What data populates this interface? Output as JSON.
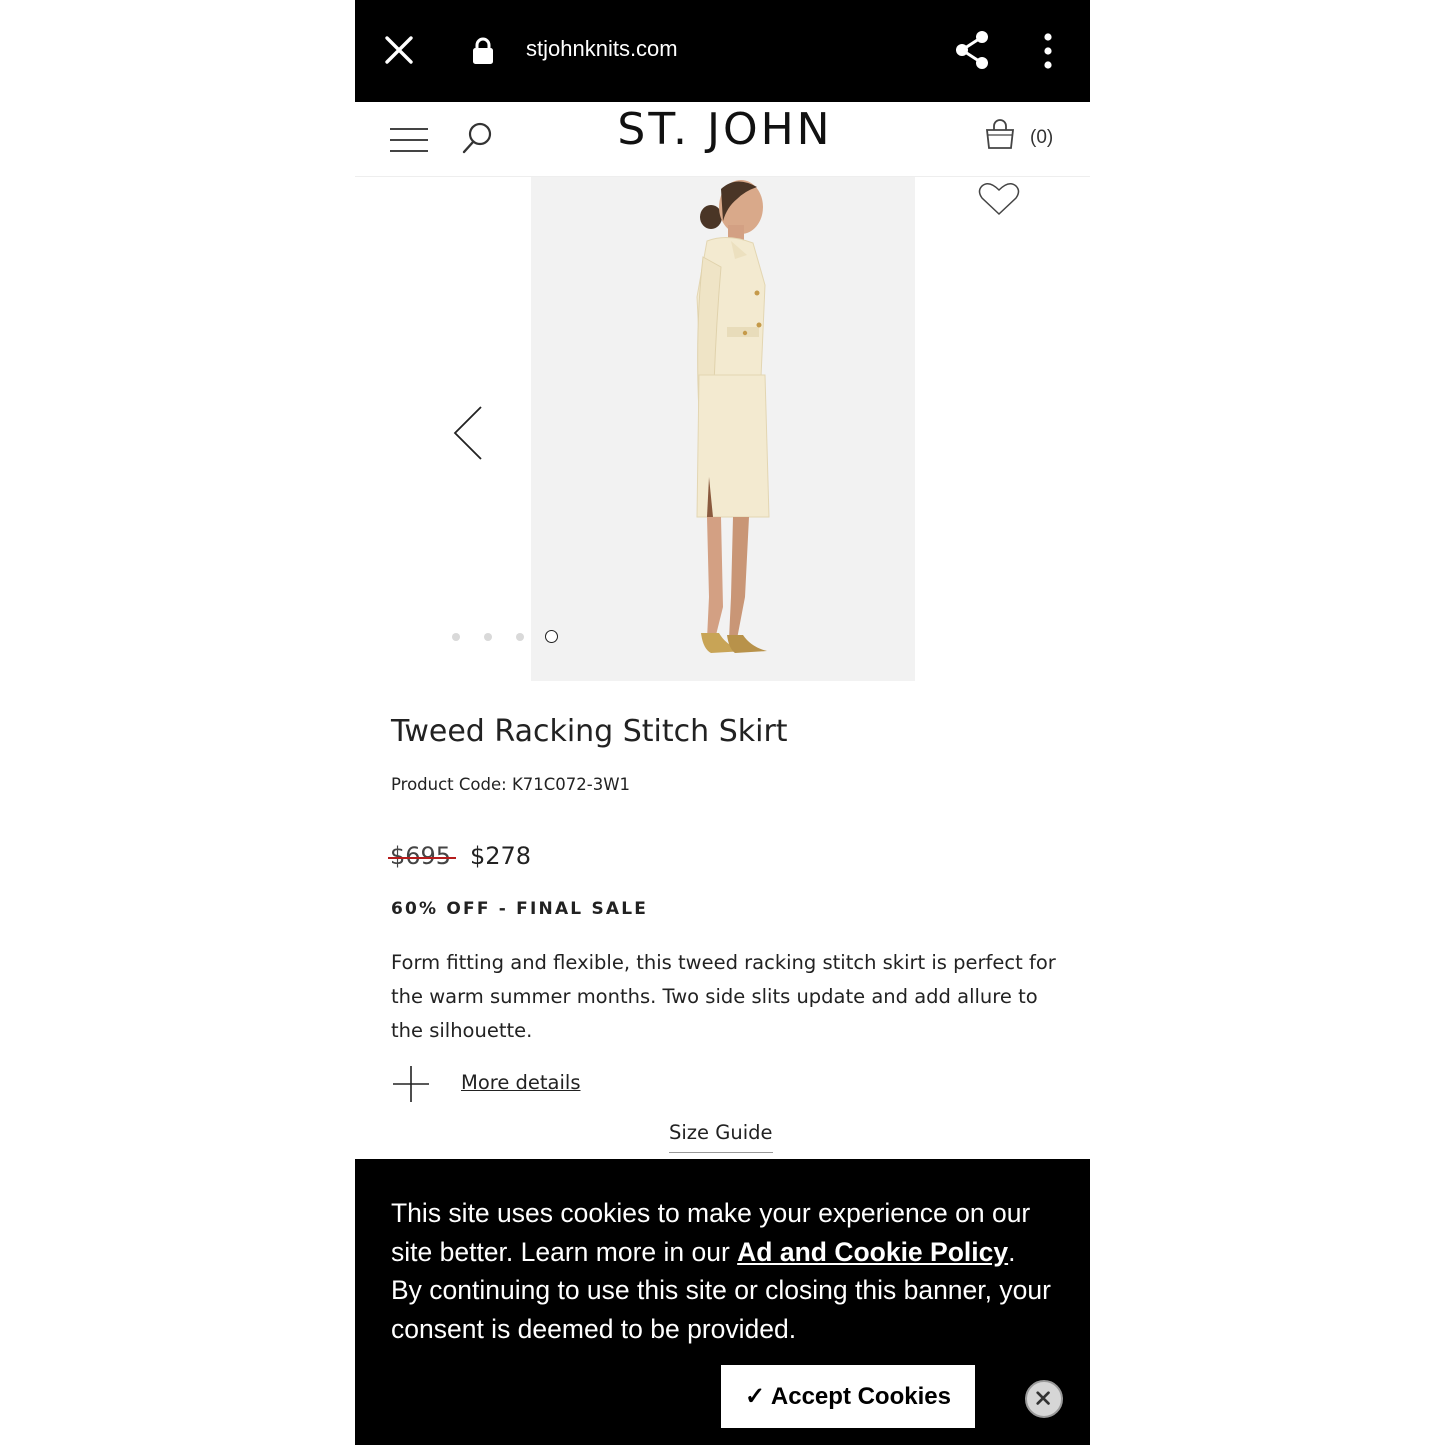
{
  "browser": {
    "url": "stjohnknits.com",
    "icons": [
      "close-icon",
      "lock-icon",
      "share-icon",
      "more-vertical-icon"
    ]
  },
  "header": {
    "logo": "ST. JOHN",
    "bag_count": "(0)",
    "icons": [
      "menu-icon",
      "search-icon",
      "shopping-bag-icon"
    ]
  },
  "gallery": {
    "icons": [
      "chevron-left-icon",
      "heart-icon"
    ],
    "image_count": 4,
    "active_index": 3
  },
  "product": {
    "title": "Tweed Racking Stitch Skirt",
    "code": "Product Code: K71C072-3W1",
    "original_price": "$695",
    "sale_price": "$278",
    "sale_label": "60% OFF - FINAL SALE",
    "description": "Form fitting and flexible, this tweed racking stitch skirt is perfect for the warm summer months. Two side slits update and add allure to the silhouette.",
    "more_details": "More details",
    "size_guide": "Size Guide"
  },
  "cookie_banner": {
    "text_before": "This site uses cookies to make your experience on our site better. Learn more in our ",
    "policy_link": "Ad and Cookie Policy",
    "text_after": ". By continuing to use this site or closing this banner, your consent is deemed to be provided.",
    "accept_label": "✓ Accept Cookies"
  },
  "colors": {
    "bar_background": "#000000",
    "strike": "#b51c1c",
    "photo_background": "#f2f2f2",
    "jacket": "#f3ead0"
  }
}
